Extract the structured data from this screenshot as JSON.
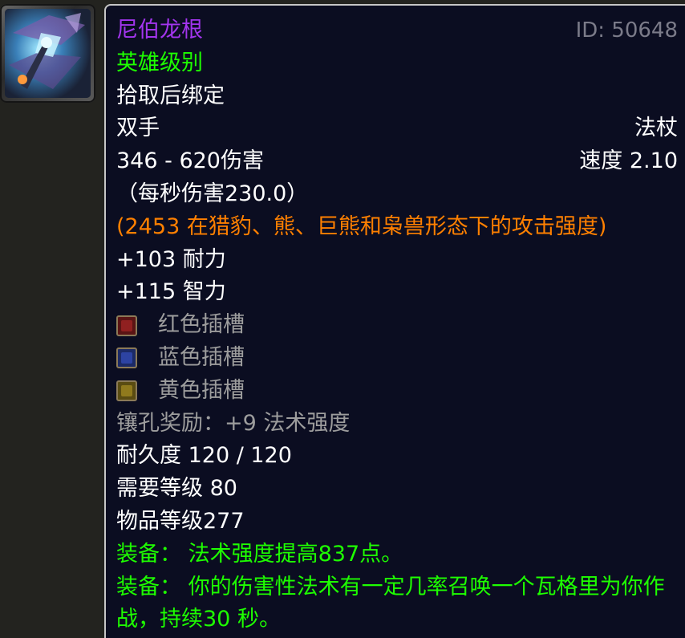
{
  "item": {
    "name": "尼伯龙根",
    "id_label": "ID: 50648",
    "quality": "英雄级别",
    "binding": "拾取后绑定",
    "slot": "双手",
    "weapon_type": "法杖",
    "damage": "346 - 620伤害",
    "speed": "速度 2.10",
    "dps": "（每秒伤害230.0）",
    "feral_ap": "(2453 在猎豹、熊、巨熊和枭兽形态下的攻击强度)",
    "stamina": "+103 耐力",
    "intellect": "+115 智力",
    "sockets": [
      {
        "color": "red",
        "label": "红色插槽"
      },
      {
        "color": "blue",
        "label": "蓝色插槽"
      },
      {
        "color": "yellow",
        "label": "黄色插槽"
      }
    ],
    "socket_bonus": "镶孔奖励：+9 法术强度",
    "durability": "耐久度 120 / 120",
    "required_level": "需要等级 80",
    "item_level": "物品等级277",
    "equip_effects": [
      "装备：  法术强度提高837点。",
      "装备：  你的伤害性法术有一定几率召唤一个瓦格里为你作战，持续30 秒。"
    ]
  },
  "colors": {
    "epic": "#a335ee",
    "green": "#1eff00",
    "orange": "#ff8000",
    "gray": "#9d9d9d",
    "background": "#0b0d21",
    "border": "#c6c6c6"
  },
  "icon": "staff-item-icon"
}
